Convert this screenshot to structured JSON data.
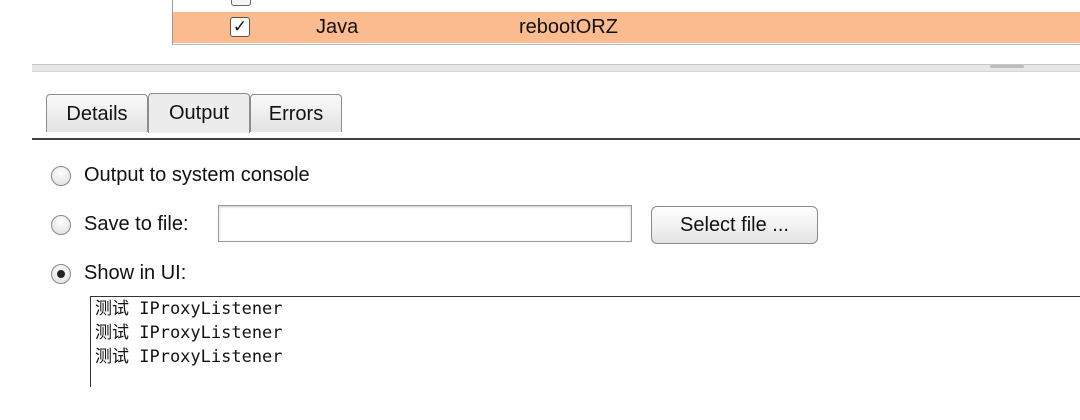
{
  "extension_table": {
    "selected_row": {
      "checked_mark": "✓",
      "type": "Java",
      "name": "rebootORZ"
    }
  },
  "tabs": [
    {
      "label": "Details",
      "active": false
    },
    {
      "label": "Output",
      "active": true
    },
    {
      "label": "Errors",
      "active": false
    }
  ],
  "output": {
    "option_console": "Output to system console",
    "option_file": "Save to file:",
    "file_value": "",
    "select_file_button": "Select file ...",
    "option_ui": "Show in UI:",
    "selected_option": "Show in UI:",
    "lines": [
      "测试 IProxyListener",
      "测试 IProxyListener",
      "测试 IProxyListener"
    ]
  },
  "colors": {
    "selected_row": "#fbbb8e"
  }
}
